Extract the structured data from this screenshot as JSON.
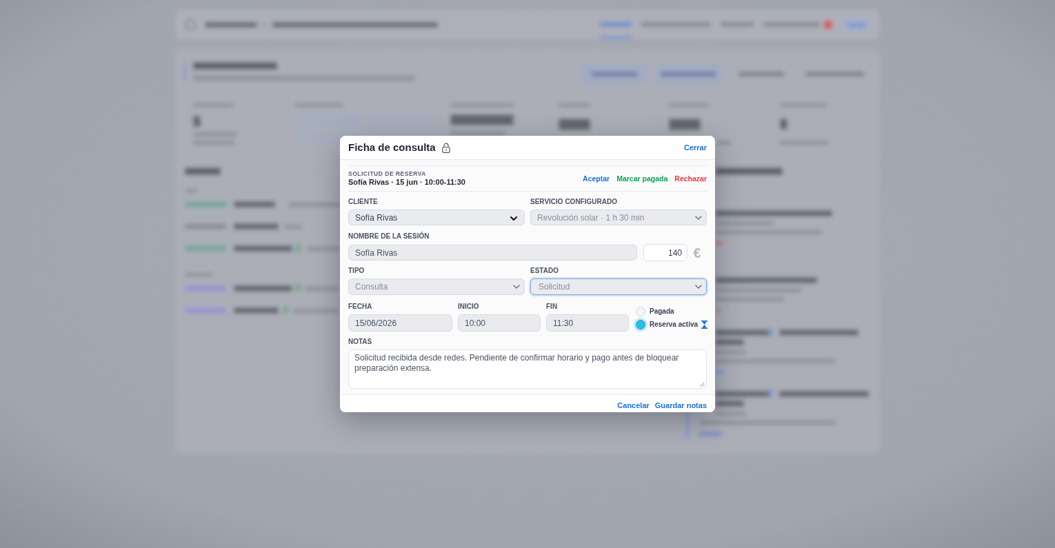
{
  "dialog": {
    "title": "Ficha de consulta",
    "close_label": "Cerrar",
    "request": {
      "heading": "SOLICITUD DE RESERVA",
      "summary": "Sofía Rivas · 15 jun · 10:00-11:30",
      "actions": [
        {
          "label": "Aceptar",
          "color": "#1a6fd6"
        },
        {
          "label": "Marcar pagada",
          "color": "#0f9f55"
        },
        {
          "label": "Rechazar",
          "color": "#e5393b"
        }
      ]
    },
    "cliente": {
      "label": "CLIENTE",
      "value": "Sofía Rivas",
      "disabled": false,
      "focused": false
    },
    "servicio": {
      "label": "SERVICIO CONFIGURADO",
      "value": "Revolución solar · 1 h 30 min",
      "disabled": true,
      "focused": false
    },
    "nombre": {
      "label": "NOMBRE DE LA SESIÓN",
      "value": "Sofía Rivas",
      "disabled": true
    },
    "precio": {
      "value": "140",
      "disabled": false,
      "currency": "€"
    },
    "tipo": {
      "label": "TIPO",
      "value": "Consulta",
      "disabled": true,
      "focused": false
    },
    "estado": {
      "label": "ESTADO",
      "value": "Solicitud",
      "disabled": true,
      "focused": true
    },
    "fecha": {
      "label": "FECHA",
      "value": "15/06/2026",
      "disabled": true
    },
    "inicio": {
      "label": "INICIO",
      "value": "10:00",
      "disabled": true
    },
    "fin": {
      "label": "FIN",
      "value": "11:30",
      "disabled": true
    },
    "status_options": [
      {
        "label": "Pagada",
        "selected": false,
        "waiting": false
      },
      {
        "label": "Reserva activa",
        "selected": true,
        "waiting": true
      }
    ],
    "notas": {
      "label": "NOTAS",
      "value": "Solicitud recibida desde redes. Pendiente de confirmar horario y pago antes de bloquear preparación extensa."
    },
    "footer_buttons": [
      {
        "label": "Cancelar"
      },
      {
        "label": "Guardar notas"
      }
    ]
  }
}
